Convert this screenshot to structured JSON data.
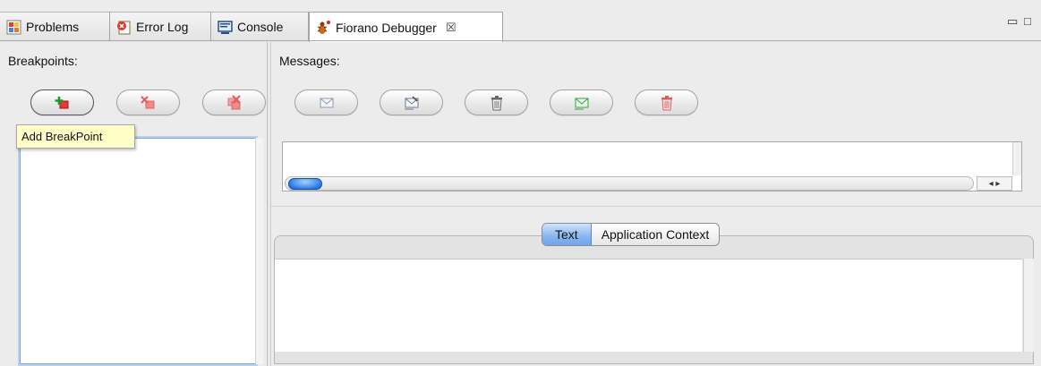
{
  "tabs": [
    {
      "label": "Problems",
      "icon": "problems-icon"
    },
    {
      "label": "Error Log",
      "icon": "error-log-icon"
    },
    {
      "label": "Console",
      "icon": "console-icon"
    },
    {
      "label": "Fiorano Debugger",
      "icon": "debugger-bug-icon",
      "active": true,
      "close": "☒"
    }
  ],
  "window_controls": {
    "minimize": "▭",
    "maximize": "□"
  },
  "breakpoints": {
    "title": "Breakpoints:",
    "tooltip": "Add BreakPoint",
    "buttons": [
      {
        "name": "add-breakpoint",
        "icon": "add-breakpoint-icon"
      },
      {
        "name": "remove-breakpoint",
        "icon": "remove-breakpoint-icon"
      },
      {
        "name": "remove-all-breakpoints",
        "icon": "remove-all-breakpoints-icon"
      }
    ]
  },
  "messages": {
    "title": "Messages:",
    "buttons": [
      {
        "name": "view-message",
        "icon": "envelope-icon"
      },
      {
        "name": "edit-message",
        "icon": "edit-envelope-icon"
      },
      {
        "name": "delete-message",
        "icon": "trash-icon"
      },
      {
        "name": "send-message",
        "icon": "send-envelope-icon"
      },
      {
        "name": "delete-all-messages",
        "icon": "red-trash-icon"
      }
    ],
    "scroll_arrows": "◂ ▸"
  },
  "detail_tabs": [
    {
      "label": "Text",
      "active": true
    },
    {
      "label": "Application Context"
    }
  ],
  "colors": {
    "accent": "#6ea5ea",
    "tooltip_bg": "#fffec6",
    "focus": "#b9d0ee"
  }
}
